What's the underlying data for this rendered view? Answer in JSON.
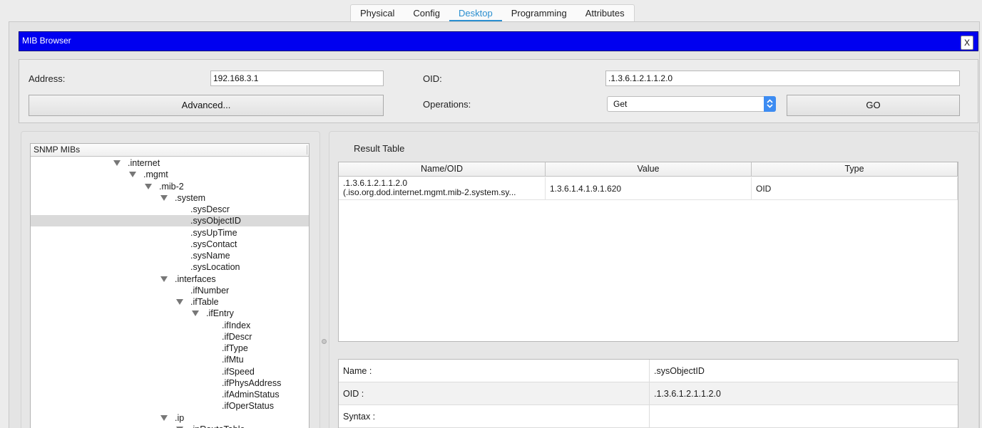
{
  "tabs": [
    {
      "label": "Physical",
      "active": false
    },
    {
      "label": "Config",
      "active": false
    },
    {
      "label": "Desktop",
      "active": true
    },
    {
      "label": "Programming",
      "active": false
    },
    {
      "label": "Attributes",
      "active": false
    }
  ],
  "window": {
    "title": "MIB Browser",
    "close_label": "X"
  },
  "form": {
    "address_label": "Address:",
    "address_value": "192.168.3.1",
    "oid_label": "OID:",
    "oid_value": ".1.3.6.1.2.1.1.2.0",
    "advanced_label": "Advanced...",
    "operations_label": "Operations:",
    "operation_value": "Get",
    "go_label": "GO"
  },
  "tree": {
    "header": "SNMP MIBs",
    "nodes": [
      {
        "label": ".internet",
        "expanded": true,
        "selected": false
      },
      {
        "label": ".mgmt",
        "expanded": true,
        "selected": false
      },
      {
        "label": ".mib-2",
        "expanded": true,
        "selected": false
      },
      {
        "label": ".system",
        "expanded": true,
        "selected": false
      },
      {
        "label": ".sysDescr",
        "expanded": false,
        "selected": false
      },
      {
        "label": ".sysObjectID",
        "expanded": false,
        "selected": true
      },
      {
        "label": ".sysUpTime",
        "expanded": false,
        "selected": false
      },
      {
        "label": ".sysContact",
        "expanded": false,
        "selected": false
      },
      {
        "label": ".sysName",
        "expanded": false,
        "selected": false
      },
      {
        "label": ".sysLocation",
        "expanded": false,
        "selected": false
      },
      {
        "label": ".interfaces",
        "expanded": true,
        "selected": false
      },
      {
        "label": ".ifNumber",
        "expanded": false,
        "selected": false
      },
      {
        "label": ".ifTable",
        "expanded": true,
        "selected": false
      },
      {
        "label": ".ifEntry",
        "expanded": true,
        "selected": false
      },
      {
        "label": ".ifIndex",
        "expanded": false,
        "selected": false
      },
      {
        "label": ".ifDescr",
        "expanded": false,
        "selected": false
      },
      {
        "label": ".ifType",
        "expanded": false,
        "selected": false
      },
      {
        "label": ".ifMtu",
        "expanded": false,
        "selected": false
      },
      {
        "label": ".ifSpeed",
        "expanded": false,
        "selected": false
      },
      {
        "label": ".ifPhysAddress",
        "expanded": false,
        "selected": false
      },
      {
        "label": ".ifAdminStatus",
        "expanded": false,
        "selected": false
      },
      {
        "label": ".ifOperStatus",
        "expanded": false,
        "selected": false
      },
      {
        "label": ".ip",
        "expanded": true,
        "selected": false
      },
      {
        "label": ".ipRouteTable",
        "expanded": true,
        "selected": false
      }
    ]
  },
  "result": {
    "title": "Result Table",
    "columns": [
      "Name/OID",
      "Value",
      "Type"
    ],
    "rows": [
      {
        "name_oid": ".1.3.6.1.2.1.1.2.0",
        "name_path": "(.iso.org.dod.internet.mgmt.mib-2.system.sy...",
        "value": "1.3.6.1.4.1.9.1.620",
        "type": "OID"
      }
    ]
  },
  "details": [
    {
      "key": "Name :",
      "value": ".sysObjectID"
    },
    {
      "key": "OID :",
      "value": ".1.3.6.1.2.1.1.2.0"
    },
    {
      "key": "Syntax :",
      "value": ""
    }
  ],
  "colors": {
    "title_bar": "#0000f0",
    "active_tab": "#2a8fd0",
    "select_arrow": "#3d8cf2"
  },
  "icons": {
    "tree_expand": "triangle-down-icon",
    "select_arrows": "up-down-chevron-icon"
  }
}
